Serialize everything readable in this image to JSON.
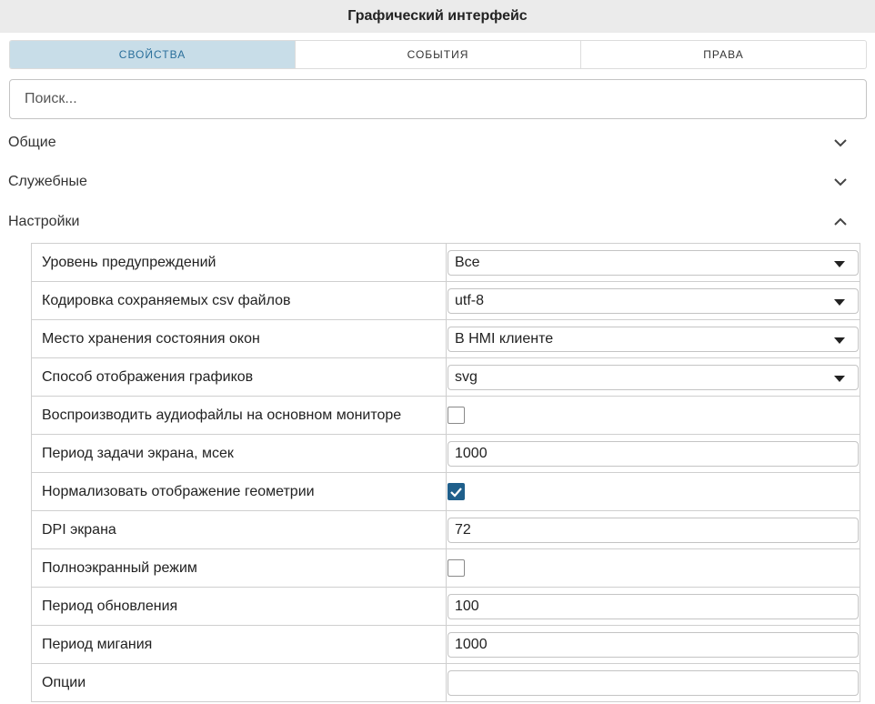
{
  "window": {
    "title": "Графический интерфейс"
  },
  "tabs": [
    {
      "label": "СВОЙСТВА",
      "active": true
    },
    {
      "label": "СОБЫТИЯ",
      "active": false
    },
    {
      "label": "ПРАВА",
      "active": false
    }
  ],
  "search": {
    "placeholder": "Поиск...",
    "value": ""
  },
  "sections": [
    {
      "label": "Общие",
      "expanded": false,
      "icon": "chevron-down-icon"
    },
    {
      "label": "Служебные",
      "expanded": false,
      "icon": "chevron-down-icon"
    },
    {
      "label": "Настройки",
      "expanded": true,
      "icon": "chevron-up-icon"
    }
  ],
  "settings": [
    {
      "label": "Уровень предупреждений",
      "type": "select",
      "value": "Все"
    },
    {
      "label": "Кодировка сохраняемых csv файлов",
      "type": "select",
      "value": "utf-8"
    },
    {
      "label": "Место хранения состояния окон",
      "type": "select",
      "value": "В HMI клиенте"
    },
    {
      "label": "Способ отображения графиков",
      "type": "select",
      "value": "svg"
    },
    {
      "label": "Воспроизводить аудиофайлы на основном мониторе",
      "type": "checkbox",
      "checked": false
    },
    {
      "label": "Период задачи экрана, мсек",
      "type": "text",
      "value": "1000"
    },
    {
      "label": "Нормализовать отображение геометрии",
      "type": "checkbox",
      "checked": true
    },
    {
      "label": "DPI экрана",
      "type": "text",
      "value": "72"
    },
    {
      "label": "Полноэкранный режим",
      "type": "checkbox",
      "checked": false
    },
    {
      "label": "Период обновления",
      "type": "text",
      "value": "100"
    },
    {
      "label": "Период мигания",
      "type": "text",
      "value": "1000"
    },
    {
      "label": "Опции",
      "type": "text",
      "value": ""
    }
  ],
  "colors": {
    "tab_active_bg": "#c8dde8",
    "tab_active_text": "#2a6f9b",
    "checkbox_checked": "#1f5f8b"
  }
}
